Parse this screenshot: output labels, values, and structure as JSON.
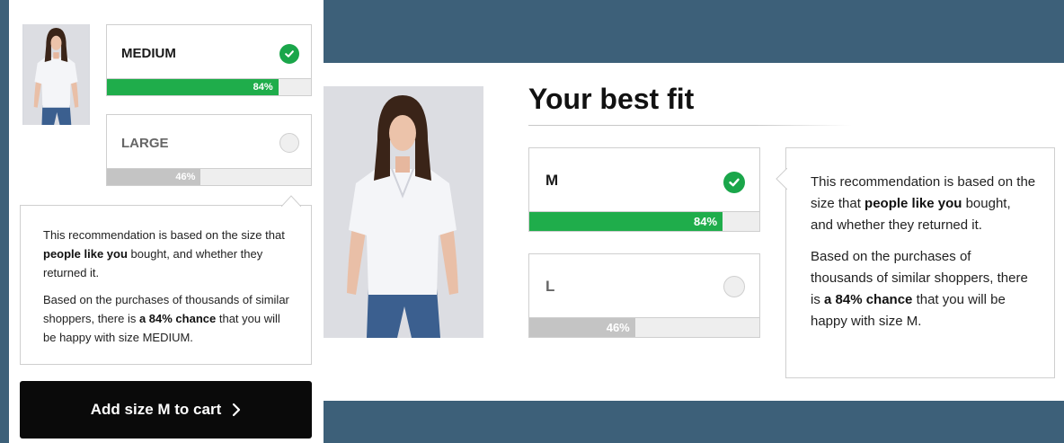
{
  "desktop": {
    "title": "Your best fit",
    "options": [
      {
        "label": "M",
        "percent_label": "84%",
        "fraction": 0.84,
        "selected": true
      },
      {
        "label": "L",
        "percent_label": "46%",
        "fraction": 0.46,
        "selected": false
      }
    ],
    "tooltip": {
      "p1_a": "This recommendation is based on the size that ",
      "p1_b": "people like you",
      "p1_c": " bought, and whether they returned it.",
      "p2_a": "Based on the purchases of thousands of similar shoppers, there is ",
      "p2_b": "a 84% chance",
      "p2_c": " that you will be happy with size M."
    }
  },
  "mobile": {
    "options": [
      {
        "label": "MEDIUM",
        "percent_label": "84%",
        "fraction": 0.84,
        "selected": true
      },
      {
        "label": "LARGE",
        "percent_label": "46%",
        "fraction": 0.46,
        "selected": false
      }
    ],
    "tooltip": {
      "p1_a": "This recommendation is based on the size that ",
      "p1_b": "people like you",
      "p1_c": " bought, and whether they returned it.",
      "p2_a": "Based on the purchases of thousands of similar shoppers, there is ",
      "p2_b": "a 84% chance",
      "p2_c": " that you will be happy with size MEDIUM."
    },
    "cart_button": "Add size M to cart"
  },
  "colors": {
    "background": "#3d6079",
    "success_green": "#1fad4b",
    "bar_grey": "#c4c4c4"
  },
  "icons": [
    "check-icon",
    "radio-icon",
    "chevron-right-icon"
  ]
}
